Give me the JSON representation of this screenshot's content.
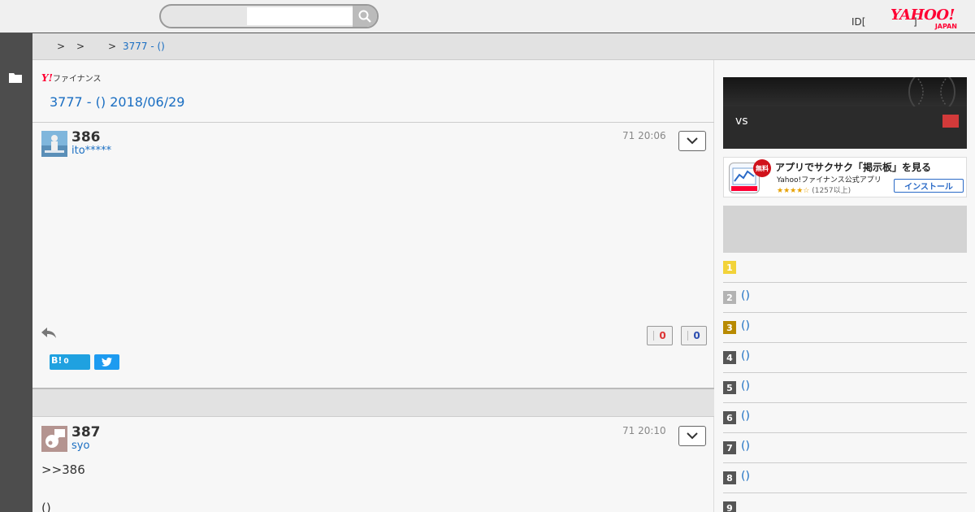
{
  "header": {
    "search_placeholder": "",
    "id_link": "ID[",
    "id_bracket": "]",
    "logo_text": "YAHOO!",
    "logo_sub": "JAPAN"
  },
  "breadcrumb": {
    "sep1": ">",
    "sep2": ">",
    "sep3": ">",
    "current": "3777 - ()"
  },
  "board": {
    "logo_y": "Y!",
    "logo_text": "ファイナンス",
    "title": "3777 - () 2018/06/29"
  },
  "posts": [
    {
      "number": "386",
      "user": "ito*****",
      "time": "71 20:06",
      "body": "",
      "votes_up": "0",
      "votes_down": "0",
      "hatena_label": "B!",
      "hatena_count": "0"
    },
    {
      "number": "387",
      "user": "syo",
      "time": "71 20:10",
      "body": ">>386",
      "body2": "()"
    }
  ],
  "sidebar": {
    "banner_vs": "vs",
    "ad": {
      "badge": "無料",
      "title": "アプリでサクサク「掲示板」を見る",
      "subtitle": "Yahoo!ファイナンス公式アプリ",
      "stars": "★★★★☆",
      "count": "(1257以上)",
      "install": "インストール"
    },
    "ranking": [
      {
        "rank": "1",
        "label": "",
        "color": "#f2d33a"
      },
      {
        "rank": "2",
        "label": "()",
        "color": "#b3b3b3"
      },
      {
        "rank": "3",
        "label": "()",
        "color": "#b88a00"
      },
      {
        "rank": "4",
        "label": "()",
        "color": "#555555"
      },
      {
        "rank": "5",
        "label": "()",
        "color": "#555555"
      },
      {
        "rank": "6",
        "label": "()",
        "color": "#555555"
      },
      {
        "rank": "7",
        "label": "()",
        "color": "#555555"
      },
      {
        "rank": "8",
        "label": "()",
        "color": "#555555"
      },
      {
        "rank": "9",
        "label": "",
        "color": "#555555"
      }
    ]
  },
  "colors": {
    "link": "#1a6ec2",
    "brand": "#ff0033",
    "vote_up": "#dd3333",
    "vote_down": "#2b4db0"
  }
}
